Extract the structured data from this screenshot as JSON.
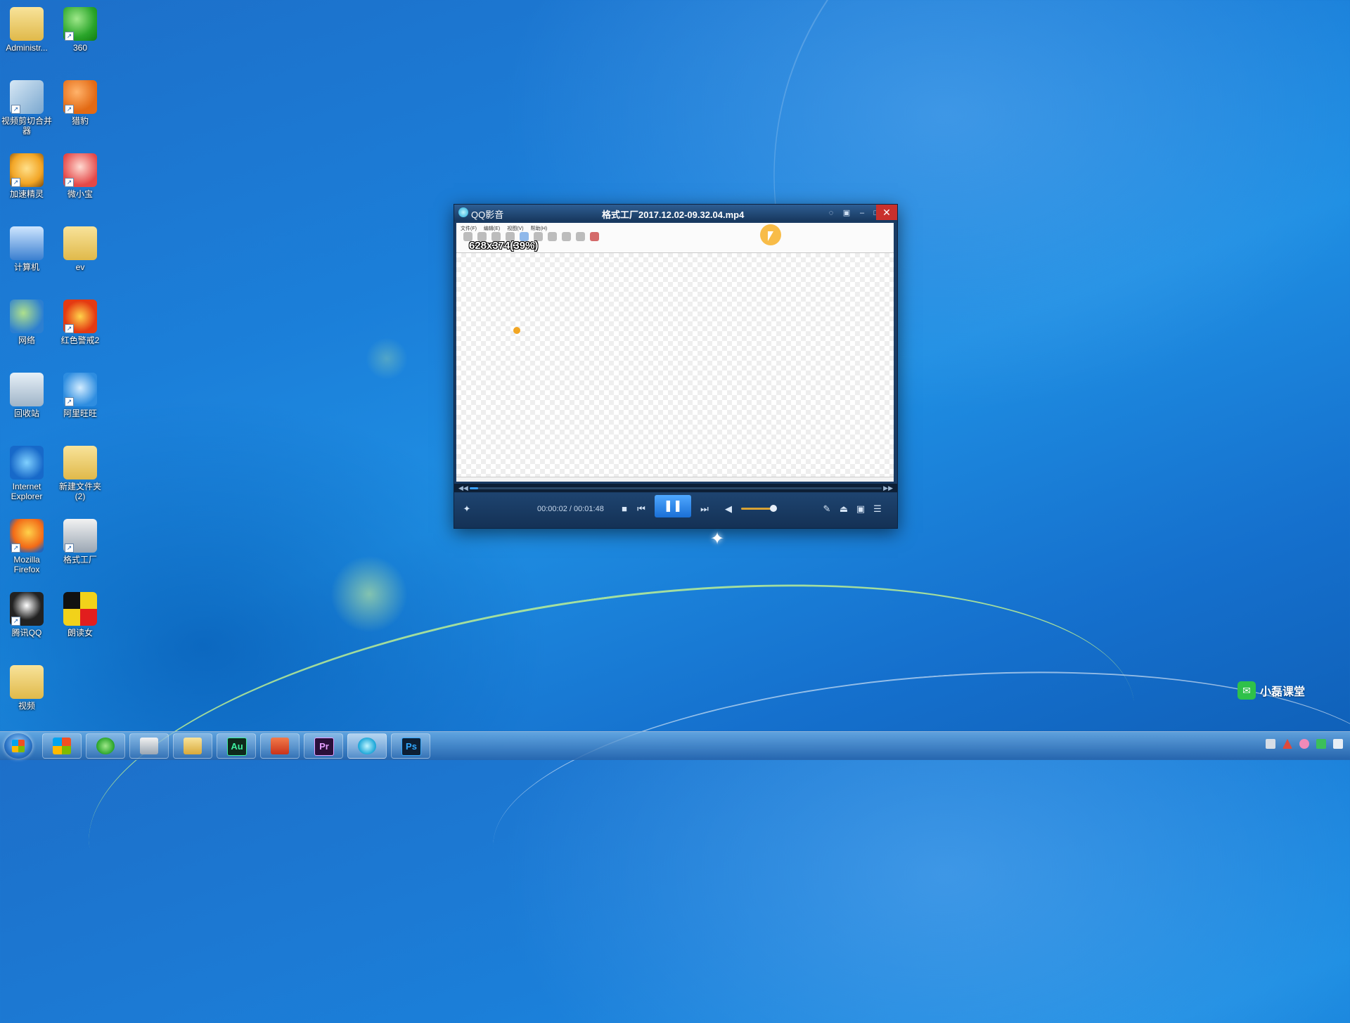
{
  "desktop": {
    "icons": [
      {
        "label": "Administr..."
      },
      {
        "label": "360"
      },
      {
        "label": "视频剪切合并器"
      },
      {
        "label": "猎豹"
      },
      {
        "label": "加速精灵"
      },
      {
        "label": "微小宝"
      },
      {
        "label": "计算机"
      },
      {
        "label": "ev"
      },
      {
        "label": "网络"
      },
      {
        "label": "红色警戒2"
      },
      {
        "label": "回收站"
      },
      {
        "label": "阿里旺旺"
      },
      {
        "label": "Internet Explorer"
      },
      {
        "label": "新建文件夹 (2)"
      },
      {
        "label": "Mozilla Firefox"
      },
      {
        "label": "格式工厂"
      },
      {
        "label": "腾讯QQ"
      },
      {
        "label": "朗读女"
      },
      {
        "label": "视频"
      }
    ]
  },
  "player": {
    "app_name": "QQ影音",
    "filename": "格式工厂2017.12.02-09.32.04.mp4",
    "video": {
      "menu": [
        "文件(F)",
        "编辑(E)",
        "视图(V)",
        "帮助(H)"
      ],
      "size_overlay": "628x374(39%)"
    },
    "progress_fraction": 0.02,
    "time": "00:00:02 / 00:01:48",
    "volume_fraction": 0.85,
    "colors": {
      "accent": "#2a7fe0",
      "close": "#c9302c"
    }
  },
  "watermark": {
    "text": "小磊课堂",
    "icon": "wechat-icon"
  },
  "taskbar": {
    "items": [
      {
        "name": "windows-store",
        "glyph": ""
      },
      {
        "name": "360-browser",
        "glyph": ""
      },
      {
        "name": "format-factory",
        "glyph": ""
      },
      {
        "name": "file-explorer",
        "glyph": ""
      },
      {
        "name": "audition",
        "glyph": "Au"
      },
      {
        "name": "office",
        "glyph": ""
      },
      {
        "name": "premiere",
        "glyph": "Pr"
      },
      {
        "name": "qq-player",
        "glyph": ""
      },
      {
        "name": "photoshop",
        "glyph": "Ps"
      }
    ]
  }
}
